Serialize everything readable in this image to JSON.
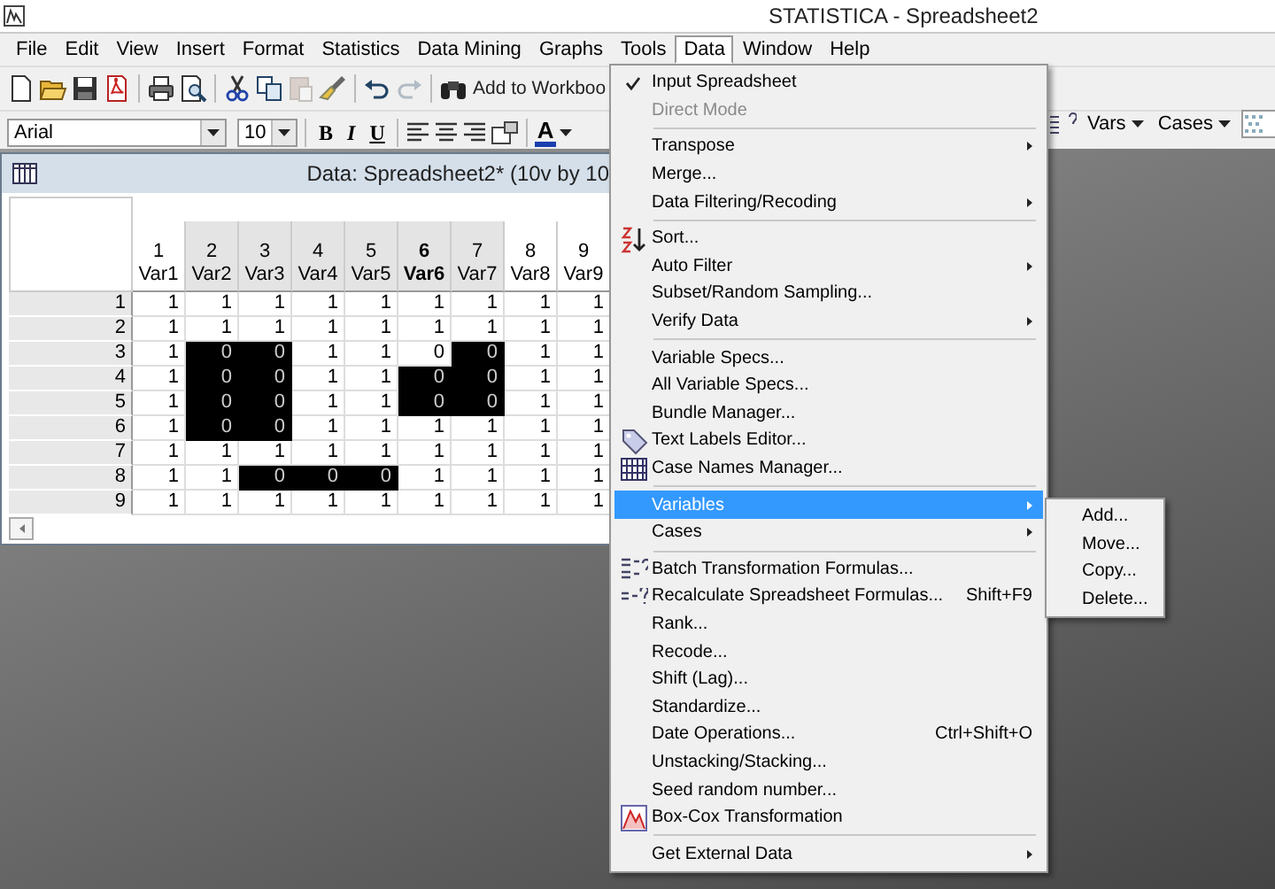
{
  "window": {
    "title": "STATISTICA - Spreadsheet2"
  },
  "menu_bar": [
    {
      "label": "File",
      "selected": false
    },
    {
      "label": "Edit",
      "selected": false
    },
    {
      "label": "View",
      "selected": false
    },
    {
      "label": "Insert",
      "selected": false
    },
    {
      "label": "Format",
      "selected": false
    },
    {
      "label": "Statistics",
      "selected": false
    },
    {
      "label": "Data Mining",
      "selected": false
    },
    {
      "label": "Graphs",
      "selected": false
    },
    {
      "label": "Tools",
      "selected": false
    },
    {
      "label": "Data",
      "selected": true
    },
    {
      "label": "Window",
      "selected": false
    },
    {
      "label": "Help",
      "selected": false
    }
  ],
  "toolbar": {
    "groups": [
      [
        {
          "kind": "new",
          "disabled": false
        },
        {
          "kind": "open",
          "disabled": false
        },
        {
          "kind": "save",
          "disabled": false
        },
        {
          "kind": "pdf",
          "disabled": false
        }
      ],
      [
        {
          "kind": "print",
          "disabled": false
        },
        {
          "kind": "preview",
          "disabled": false
        }
      ],
      [
        {
          "kind": "cut",
          "disabled": false
        },
        {
          "kind": "copy",
          "disabled": false
        },
        {
          "kind": "paste",
          "disabled": true
        },
        {
          "kind": "brush",
          "disabled": false
        }
      ],
      [
        {
          "kind": "undo",
          "disabled": false
        },
        {
          "kind": "redo",
          "disabled": true
        }
      ],
      [
        {
          "kind": "find",
          "disabled": false
        }
      ]
    ],
    "workbook_button": "Add to Workboo"
  },
  "format_toolbar": {
    "font": "Arial",
    "size": "10",
    "bold": "B",
    "italic": "I",
    "underline": "U",
    "color_letter": "A"
  },
  "right_toolbar": {
    "vars": "Vars",
    "cases": "Cases"
  },
  "spreadsheet": {
    "title": "Data: Spreadsheet2* (10v by 10",
    "columns": [
      {
        "number": "1",
        "name": "Var1",
        "selected": false,
        "current": false
      },
      {
        "number": "2",
        "name": "Var2",
        "selected": true,
        "current": false
      },
      {
        "number": "3",
        "name": "Var3",
        "selected": true,
        "current": false
      },
      {
        "number": "4",
        "name": "Var4",
        "selected": true,
        "current": false
      },
      {
        "number": "5",
        "name": "Var5",
        "selected": true,
        "current": false
      },
      {
        "number": "6",
        "name": "Var6",
        "selected": true,
        "current": true
      },
      {
        "number": "7",
        "name": "Var7",
        "selected": true,
        "current": false
      },
      {
        "number": "8",
        "name": "Var8",
        "selected": false,
        "current": false
      },
      {
        "number": "9",
        "name": "Var9",
        "selected": false,
        "current": false
      }
    ],
    "rows": [
      {
        "label": "1",
        "cells": [
          {
            "value": "1",
            "selected": false
          },
          {
            "value": "1",
            "selected": false
          },
          {
            "value": "1",
            "selected": false
          },
          {
            "value": "1",
            "selected": false
          },
          {
            "value": "1",
            "selected": false
          },
          {
            "value": "1",
            "selected": false
          },
          {
            "value": "1",
            "selected": false
          },
          {
            "value": "1",
            "selected": false
          },
          {
            "value": "1",
            "selected": false
          }
        ]
      },
      {
        "label": "2",
        "cells": [
          {
            "value": "1",
            "selected": false
          },
          {
            "value": "1",
            "selected": false
          },
          {
            "value": "1",
            "selected": false
          },
          {
            "value": "1",
            "selected": false
          },
          {
            "value": "1",
            "selected": false
          },
          {
            "value": "1",
            "selected": false
          },
          {
            "value": "1",
            "selected": false
          },
          {
            "value": "1",
            "selected": false
          },
          {
            "value": "1",
            "selected": false
          }
        ]
      },
      {
        "label": "3",
        "cells": [
          {
            "value": "1",
            "selected": false
          },
          {
            "value": "0",
            "selected": true
          },
          {
            "value": "0",
            "selected": true
          },
          {
            "value": "1",
            "selected": false
          },
          {
            "value": "1",
            "selected": false
          },
          {
            "value": "0",
            "selected": false
          },
          {
            "value": "0",
            "selected": true
          },
          {
            "value": "1",
            "selected": false
          },
          {
            "value": "1",
            "selected": false
          }
        ]
      },
      {
        "label": "4",
        "cells": [
          {
            "value": "1",
            "selected": false
          },
          {
            "value": "0",
            "selected": true
          },
          {
            "value": "0",
            "selected": true
          },
          {
            "value": "1",
            "selected": false
          },
          {
            "value": "1",
            "selected": false
          },
          {
            "value": "0",
            "selected": true
          },
          {
            "value": "0",
            "selected": true
          },
          {
            "value": "1",
            "selected": false
          },
          {
            "value": "1",
            "selected": false
          }
        ]
      },
      {
        "label": "5",
        "cells": [
          {
            "value": "1",
            "selected": false
          },
          {
            "value": "0",
            "selected": true
          },
          {
            "value": "0",
            "selected": true
          },
          {
            "value": "1",
            "selected": false
          },
          {
            "value": "1",
            "selected": false
          },
          {
            "value": "0",
            "selected": true
          },
          {
            "value": "0",
            "selected": true
          },
          {
            "value": "1",
            "selected": false
          },
          {
            "value": "1",
            "selected": false
          }
        ]
      },
      {
        "label": "6",
        "cells": [
          {
            "value": "1",
            "selected": false
          },
          {
            "value": "0",
            "selected": true
          },
          {
            "value": "0",
            "selected": true
          },
          {
            "value": "1",
            "selected": false
          },
          {
            "value": "1",
            "selected": false
          },
          {
            "value": "1",
            "selected": false
          },
          {
            "value": "1",
            "selected": false
          },
          {
            "value": "1",
            "selected": false
          },
          {
            "value": "1",
            "selected": false
          }
        ]
      },
      {
        "label": "7",
        "cells": [
          {
            "value": "1",
            "selected": false
          },
          {
            "value": "1",
            "selected": false
          },
          {
            "value": "1",
            "selected": false
          },
          {
            "value": "1",
            "selected": false
          },
          {
            "value": "1",
            "selected": false
          },
          {
            "value": "1",
            "selected": false
          },
          {
            "value": "1",
            "selected": false
          },
          {
            "value": "1",
            "selected": false
          },
          {
            "value": "1",
            "selected": false
          }
        ]
      },
      {
        "label": "8",
        "cells": [
          {
            "value": "1",
            "selected": false
          },
          {
            "value": "1",
            "selected": false
          },
          {
            "value": "0",
            "selected": true
          },
          {
            "value": "0",
            "selected": true
          },
          {
            "value": "0",
            "selected": true
          },
          {
            "value": "1",
            "selected": false
          },
          {
            "value": "1",
            "selected": false
          },
          {
            "value": "1",
            "selected": false
          },
          {
            "value": "1",
            "selected": false
          }
        ]
      },
      {
        "label": "9",
        "cells": [
          {
            "value": "1",
            "selected": false
          },
          {
            "value": "1",
            "selected": false
          },
          {
            "value": "1",
            "selected": false
          },
          {
            "value": "1",
            "selected": false
          },
          {
            "value": "1",
            "selected": false
          },
          {
            "value": "1",
            "selected": false
          },
          {
            "value": "1",
            "selected": false
          },
          {
            "value": "1",
            "selected": false
          },
          {
            "value": "1",
            "selected": false
          }
        ]
      }
    ]
  },
  "data_menu": [
    {
      "kind": "plain",
      "label": "Input Spreadsheet",
      "checked": true,
      "disabled": false,
      "selected": false,
      "submenu": false
    },
    {
      "kind": "plain",
      "label": "Direct Mode",
      "checked": false,
      "disabled": true,
      "selected": false,
      "submenu": false
    },
    {
      "kind": "separator"
    },
    {
      "kind": "plain",
      "label": "Transpose",
      "checked": false,
      "disabled": false,
      "selected": false,
      "submenu": true
    },
    {
      "kind": "plain",
      "label": "Merge...",
      "checked": false,
      "disabled": false,
      "selected": false,
      "submenu": false
    },
    {
      "kind": "plain",
      "label": "Data Filtering/Recoding",
      "checked": false,
      "disabled": false,
      "selected": false,
      "submenu": true
    },
    {
      "kind": "separator"
    },
    {
      "kind": "sort",
      "label": "Sort...",
      "checked": false,
      "disabled": false,
      "selected": false,
      "submenu": false
    },
    {
      "kind": "plain",
      "label": "Auto Filter",
      "checked": false,
      "disabled": false,
      "selected": false,
      "submenu": true
    },
    {
      "kind": "plain",
      "label": "Subset/Random Sampling...",
      "checked": false,
      "disabled": false,
      "selected": false,
      "submenu": false
    },
    {
      "kind": "plain",
      "label": "Verify Data",
      "checked": false,
      "disabled": false,
      "selected": false,
      "submenu": true
    },
    {
      "kind": "separator"
    },
    {
      "kind": "plain",
      "label": "Variable Specs...",
      "checked": false,
      "disabled": false,
      "selected": false,
      "submenu": false
    },
    {
      "kind": "plain",
      "label": "All Variable Specs...",
      "checked": false,
      "disabled": false,
      "selected": false,
      "submenu": false
    },
    {
      "kind": "plain",
      "label": "Bundle Manager...",
      "checked": false,
      "disabled": false,
      "selected": false,
      "submenu": false
    },
    {
      "kind": "tag",
      "label": "Text Labels Editor...",
      "checked": false,
      "disabled": false,
      "selected": false,
      "submenu": false
    },
    {
      "kind": "grid",
      "label": "Case Names Manager...",
      "checked": false,
      "disabled": false,
      "selected": false,
      "submenu": false
    },
    {
      "kind": "separator"
    },
    {
      "kind": "plain",
      "label": "Variables",
      "checked": false,
      "disabled": false,
      "selected": true,
      "submenu": true
    },
    {
      "kind": "plain",
      "label": "Cases",
      "checked": false,
      "disabled": false,
      "selected": false,
      "submenu": true
    },
    {
      "kind": "separator"
    },
    {
      "kind": "formula",
      "label": "Batch Transformation Formulas...",
      "checked": false,
      "disabled": false,
      "selected": false,
      "submenu": false
    },
    {
      "kind": "recalc",
      "label": "Recalculate Spreadsheet Formulas...",
      "shortcut": "Shift+F9",
      "checked": false,
      "disabled": false,
      "selected": false,
      "submenu": false
    },
    {
      "kind": "plain",
      "label": "Rank...",
      "checked": false,
      "disabled": false,
      "selected": false,
      "submenu": false
    },
    {
      "kind": "plain",
      "label": "Recode...",
      "checked": false,
      "disabled": false,
      "selected": false,
      "submenu": false
    },
    {
      "kind": "plain",
      "label": "Shift (Lag)...",
      "checked": false,
      "disabled": false,
      "selected": false,
      "submenu": false
    },
    {
      "kind": "plain",
      "label": "Standardize...",
      "checked": false,
      "disabled": false,
      "selected": false,
      "submenu": false
    },
    {
      "kind": "plain",
      "label": "Date Operations...",
      "shortcut": "Ctrl+Shift+O",
      "checked": false,
      "disabled": false,
      "selected": false,
      "submenu": false
    },
    {
      "kind": "plain",
      "label": "Unstacking/Stacking...",
      "checked": false,
      "disabled": false,
      "selected": false,
      "submenu": false
    },
    {
      "kind": "plain",
      "label": "Seed random number...",
      "checked": false,
      "disabled": false,
      "selected": false,
      "submenu": false
    },
    {
      "kind": "chart",
      "label": "Box-Cox Transformation",
      "checked": false,
      "disabled": false,
      "selected": false,
      "submenu": false
    },
    {
      "kind": "separator"
    },
    {
      "kind": "plain",
      "label": "Get External Data",
      "checked": false,
      "disabled": false,
      "selected": false,
      "submenu": true
    }
  ],
  "variables_submenu": [
    {
      "label": "Add...",
      "selected": false
    },
    {
      "label": "Move...",
      "selected": false
    },
    {
      "label": "Copy...",
      "selected": false
    },
    {
      "label": "Delete...",
      "selected": false
    }
  ]
}
